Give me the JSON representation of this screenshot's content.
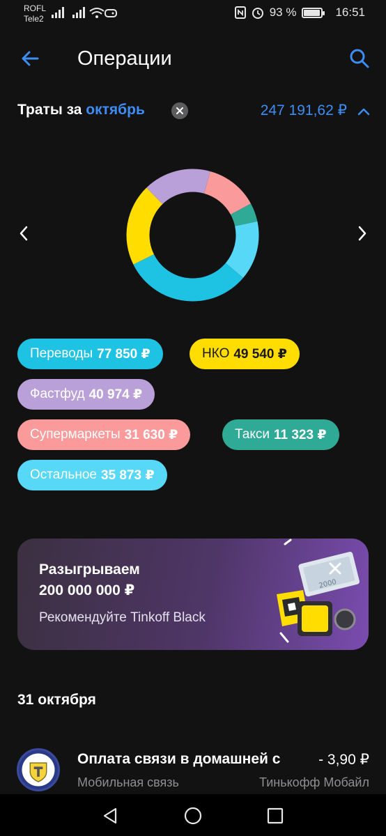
{
  "status_bar": {
    "carrier_1": "ROFL",
    "carrier_2": "Tele2",
    "battery": "93 %",
    "battery_level": 0.93,
    "time": "16:51"
  },
  "header": {
    "title": "Операции"
  },
  "spending": {
    "label": "Траты за",
    "month": "октябрь",
    "total": "247 191,62 ₽"
  },
  "chart_data": {
    "type": "pie",
    "categories": [
      "Переводы",
      "НКО",
      "Фастфуд",
      "Супермаркеты",
      "Такси",
      "Остальное"
    ],
    "values": [
      77850,
      49540,
      40974,
      31630,
      11323,
      35873
    ],
    "colors": [
      "#1ec3e4",
      "#ffdd00",
      "#b9a0d8",
      "#fb9a9a",
      "#2faa96",
      "#56d8f6"
    ]
  },
  "categories": [
    {
      "name": "Переводы",
      "amount": "77 850 ₽",
      "color": "#1ec3e4",
      "text_color": "#ffffff"
    },
    {
      "name": "НКО",
      "amount": "49 540 ₽",
      "color": "#ffdd00",
      "text_color": "#1a1a1a"
    },
    {
      "name": "Фастфуд",
      "amount": "40 974 ₽",
      "color": "#b9a0d8",
      "text_color": "#ffffff"
    },
    {
      "name": "Супермаркеты",
      "amount": "31 630 ₽",
      "color": "#fb9a9a",
      "text_color": "#ffffff"
    },
    {
      "name": "Такси",
      "amount": "11 323 ₽",
      "color": "#2faa96",
      "text_color": "#ffffff"
    },
    {
      "name": "Остальное",
      "amount": "35 873 ₽",
      "color": "#56d8f6",
      "text_color": "#ffffff"
    }
  ],
  "promo": {
    "title_line1": "Разыгрываем",
    "title_line2": "200 000 000 ₽",
    "subtitle": "Рекомендуйте Tinkoff Black",
    "banknote_value": "2000"
  },
  "operations": {
    "date": "31 октября",
    "items": [
      {
        "title": "Оплата связи в домашней с",
        "amount": "- 3,90 ₽",
        "category": "Мобильная связь",
        "bank": "Тинькофф Мобайл"
      }
    ]
  },
  "colors": {
    "accent": "#3d8df5",
    "background": "#121212"
  }
}
